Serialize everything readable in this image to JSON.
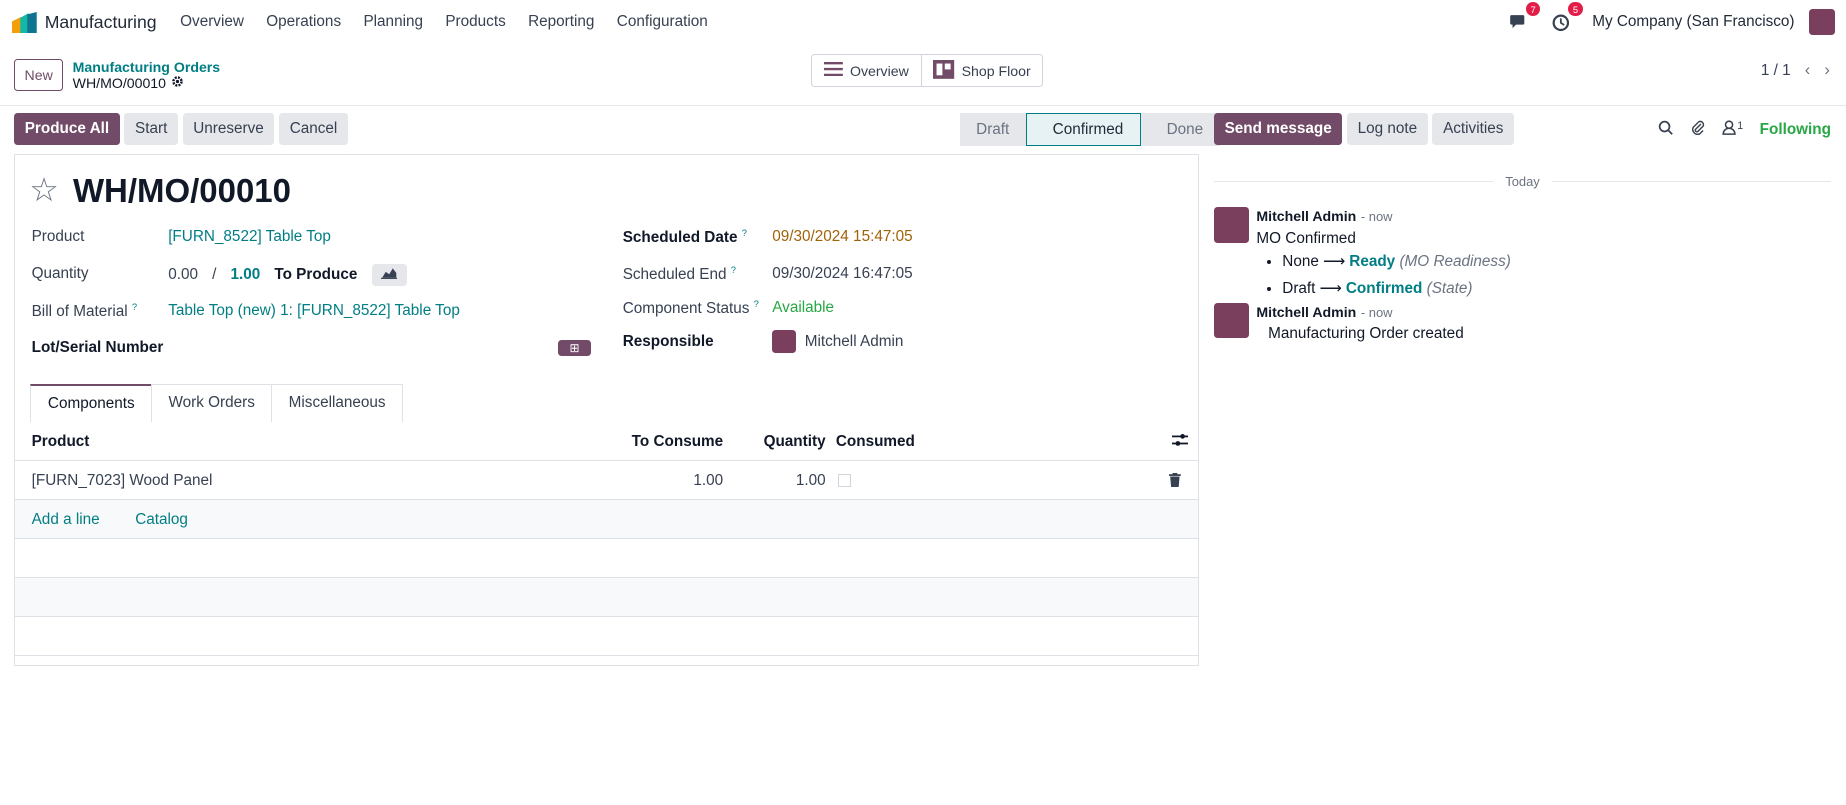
{
  "navbar": {
    "app": "Manufacturing",
    "menu": [
      "Overview",
      "Operations",
      "Planning",
      "Products",
      "Reporting",
      "Configuration"
    ],
    "messages_count": "7",
    "activities_count": "5",
    "company": "My Company (San Francisco)"
  },
  "control": {
    "new_label": "New",
    "breadcrumb_parent": "Manufacturing Orders",
    "breadcrumb_current": "WH/MO/00010",
    "overview_label": "Overview",
    "shop_floor_label": "Shop Floor",
    "pager": "1 / 1"
  },
  "actions": {
    "produce_all": "Produce All",
    "start": "Start",
    "unreserve": "Unreserve",
    "cancel": "Cancel"
  },
  "status": [
    "Draft",
    "Confirmed",
    "Done"
  ],
  "form": {
    "title": "WH/MO/00010",
    "product_label": "Product",
    "product_value": "[FURN_8522] Table Top",
    "quantity_label": "Quantity",
    "qty_produced": "0.00",
    "qty_sep": "/",
    "qty_total": "1.00",
    "to_produce": "To Produce",
    "bom_label": "Bill of Material",
    "bom_value": "Table Top (new) 1: [FURN_8522] Table Top",
    "lot_label": "Lot/Serial Number",
    "sched_date_label": "Scheduled Date",
    "sched_date_value": "09/30/2024 15:47:05",
    "sched_end_label": "Scheduled End",
    "sched_end_value": "09/30/2024 16:47:05",
    "comp_status_label": "Component Status",
    "comp_status_value": "Available",
    "responsible_label": "Responsible",
    "responsible_value": "Mitchell Admin",
    "help_mark": "?"
  },
  "tabs": [
    "Components",
    "Work Orders",
    "Miscellaneous"
  ],
  "table": {
    "headers": [
      "Product",
      "To Consume",
      "Quantity",
      "Consumed"
    ],
    "rows": [
      {
        "product": "[FURN_7023] Wood Panel",
        "to_consume": "1.00",
        "quantity": "1.00"
      }
    ],
    "add_line": "Add a line",
    "catalog": "Catalog"
  },
  "chatter": {
    "send_message": "Send message",
    "log_note": "Log note",
    "activities": "Activities",
    "followers_count": "1",
    "following": "Following",
    "today": "Today",
    "messages": [
      {
        "author": "Mitchell Admin",
        "time": "- now",
        "text": "MO Confirmed",
        "changes": [
          {
            "from": "None",
            "to": "Ready",
            "field": "(MO Readiness)"
          },
          {
            "from": "Draft",
            "to": "Confirmed",
            "field": "(State)"
          }
        ]
      },
      {
        "author": "Mitchell Admin",
        "time": "- now",
        "text": "Manufacturing Order created"
      }
    ]
  }
}
